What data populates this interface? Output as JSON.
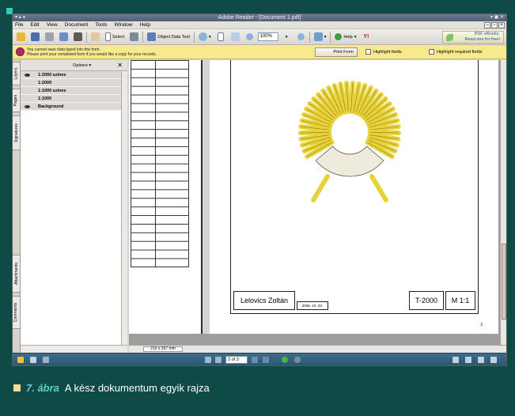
{
  "window": {
    "title": "Adobe Reader - [Document 1.pdf]"
  },
  "menu": [
    "File",
    "Edit",
    "View",
    "Document",
    "Tools",
    "Window",
    "Help"
  ],
  "toolbar": {
    "select_label": "Select",
    "object_data_label": "Object Data Tool",
    "zoom_value": "100%",
    "help_label": "Help",
    "promo_line1": "PDF eBooks.",
    "promo_line2": "Read one for free!"
  },
  "formbar": {
    "message_line1": "You cannot save data typed into this form.",
    "message_line2": "Please print your completed form if you would like a copy for your records.",
    "print_form_label": "Print Form",
    "highlight_fields_label": "Highlight fields",
    "highlight_required_label": "Highlight required fields"
  },
  "navtabs": [
    "Layers",
    "Pages",
    "Signatures",
    "Attachments",
    "Comments"
  ],
  "layers_panel": {
    "options_label": "Options",
    "close_symbol": "✕",
    "items": [
      {
        "name": "1:2000 színes",
        "visible": true
      },
      {
        "name": "1:2000",
        "visible": false
      },
      {
        "name": "1:1000 színes",
        "visible": false
      },
      {
        "name": "1:1000",
        "visible": false
      },
      {
        "name": "Background",
        "visible": true
      }
    ]
  },
  "drawing": {
    "author": "Lelovics Zoltán",
    "date": "2006. 10. 23.",
    "code": "T-2000",
    "scale": "M 1:1",
    "page_number": "3"
  },
  "hbar": {
    "page_size": "210 x 297 mm"
  },
  "statusbar": {
    "page_indicator": "3 of 3"
  },
  "caption": {
    "figure_number": "7. ábra",
    "text": "A kész dokumentum egyik rajza"
  },
  "colors": {
    "background": "#0f4a47",
    "accent": "#35c8c0",
    "coil_fill": "#e8d23a",
    "coil_stroke": "#8c7a10",
    "core_fill": "#eeeadc"
  }
}
